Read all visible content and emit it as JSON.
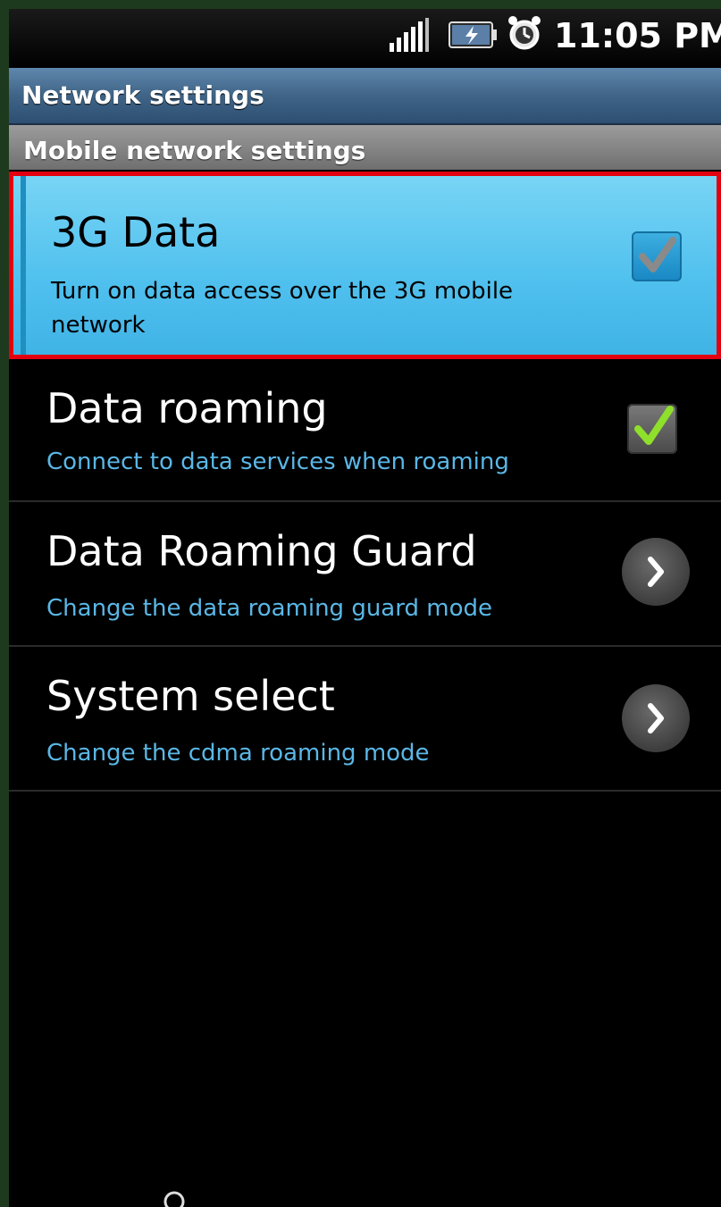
{
  "status_bar": {
    "time": "11:05 PM",
    "icons": [
      "signal-icon",
      "battery-charging-icon",
      "alarm-clock-icon"
    ]
  },
  "title_bar": {
    "title": "Network settings"
  },
  "section": {
    "header": "Mobile network settings"
  },
  "settings": [
    {
      "title": "3G Data",
      "summary": "Turn on data access over the 3G mobile network",
      "control": "checkbox",
      "checked": true,
      "highlighted": true
    },
    {
      "title": "Data roaming",
      "summary": "Connect to data services when roaming",
      "control": "checkbox",
      "checked": true,
      "highlighted": false
    },
    {
      "title": "Data Roaming Guard",
      "summary": "Change the data roaming guard mode",
      "control": "chevron-right-icon"
    },
    {
      "title": "System select",
      "summary": "Change the cdma roaming mode",
      "control": "chevron-right-icon"
    }
  ],
  "colors": {
    "highlight": "#4fc0ee",
    "selection_border": "#e3000f",
    "summary_text": "#5ab7e6",
    "check_green": "#8ee02a",
    "title_bar": "#3f6487"
  }
}
